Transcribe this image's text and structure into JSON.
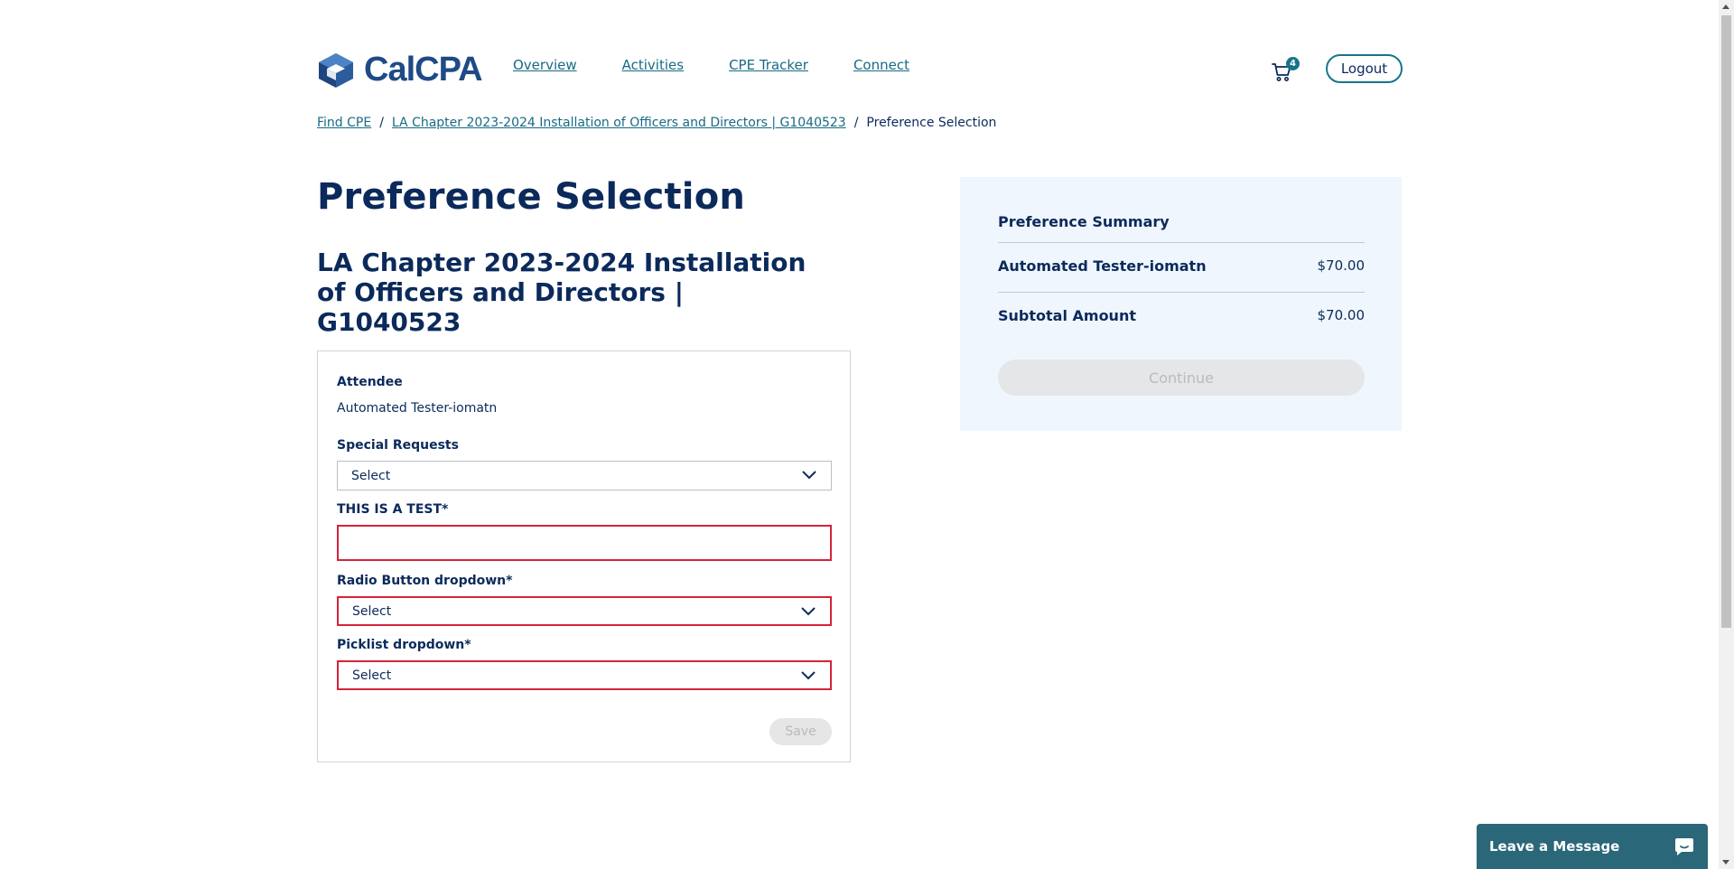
{
  "header": {
    "logo_text": "CalCPA",
    "nav": [
      {
        "label": "Overview"
      },
      {
        "label": "Activities"
      },
      {
        "label": "CPE Tracker"
      },
      {
        "label": "Connect"
      }
    ],
    "cart_count": "4",
    "logout_label": "Logout"
  },
  "breadcrumb": {
    "items": [
      {
        "label": "Find CPE"
      },
      {
        "label": "LA Chapter 2023-2024 Installation of Officers and Directors | G1040523"
      },
      {
        "label": "Preference Selection"
      }
    ],
    "separator": "/"
  },
  "page": {
    "title": "Preference Selection",
    "event_title": "LA Chapter 2023-2024 Installation of Officers and Directors | G1040523"
  },
  "form": {
    "attendee_label": "Attendee",
    "attendee_value": "Automated Tester-iomatn",
    "special_requests_label": "Special Requests",
    "special_requests_value": "Select",
    "test_field_label": "THIS IS A TEST*",
    "test_field_value": "",
    "radio_dropdown_label": "Radio Button dropdown*",
    "radio_dropdown_value": "Select",
    "picklist_label": "Picklist dropdown*",
    "picklist_value": "Select",
    "save_label": "Save"
  },
  "summary": {
    "title": "Preference Summary",
    "rows": [
      {
        "label": "Automated Tester-iomatn",
        "value": "$70.00"
      }
    ],
    "subtotal_label": "Subtotal Amount",
    "subtotal_value": "$70.00",
    "continue_label": "Continue"
  },
  "chat": {
    "label": "Leave a Message"
  },
  "colors": {
    "primary_text": "#0b2a5b",
    "link": "#186a85",
    "accent": "#16758c",
    "error": "#d6233a",
    "summary_bg": "#eff6fd",
    "chat_bg": "#2a6778"
  }
}
